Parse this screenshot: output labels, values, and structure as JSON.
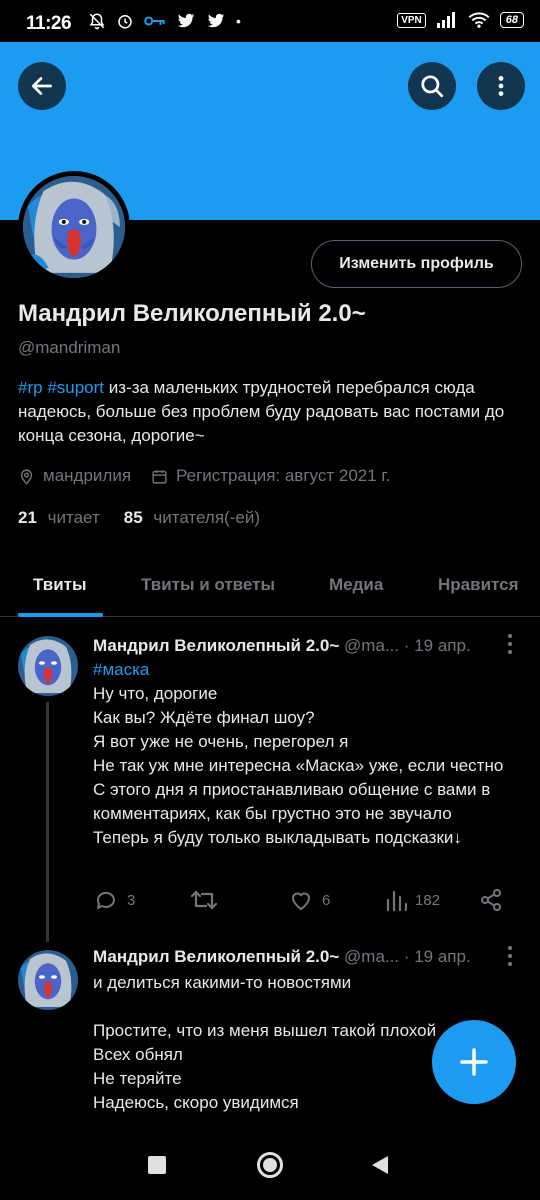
{
  "status_bar": {
    "time": "11:26",
    "vpn": "VPN",
    "battery": "68"
  },
  "profile": {
    "name": "Мандрил Великолепный 2.0~",
    "handle": "@mandriman",
    "edit_button": "Изменить профиль",
    "bio_tags": [
      "#rp",
      "#suport"
    ],
    "bio_text": "из-за маленьких трудностей перебрался сюда надеюсь, больше без проблем буду радовать вас постами до конца сезона, дорогие~",
    "location": "мандрилия",
    "joined": "Регистрация: август 2021 г.",
    "following_count": "21",
    "following_label": "читает",
    "followers_count": "85",
    "followers_label": "читателя(-ей)"
  },
  "tabs": [
    {
      "label": "Твиты"
    },
    {
      "label": "Твиты и ответы"
    },
    {
      "label": "Медиа"
    },
    {
      "label": "Нравится"
    }
  ],
  "tweets": [
    {
      "name": "Мандрил Великолепный 2.0~",
      "handle": "@ma...",
      "date": "· 19 апр.",
      "hashtag": "#маска",
      "lines": [
        "Ну что, дорогие",
        "Как вы? Ждёте финал шоу?",
        "Я вот уже не очень, перегорел я",
        "Не так уж мне интересна «Маска» уже, если честно",
        "С этого дня я приостанавливаю общение с вами в комментариях, как бы грустно это не звучало",
        "Теперь я буду только выкладывать подсказки↓"
      ],
      "replies": "3",
      "retweets": "",
      "likes": "6",
      "views": "182"
    },
    {
      "name": "Мандрил Великолепный 2.0~",
      "handle": "@ma...",
      "date": "· 19 апр.",
      "lines": [
        "и делиться какими-то новостями",
        "",
        "Простите, что из меня вышел такой плохой ...а:(",
        "Всех обнял",
        "Не теряйте",
        "Надеюсь, скоро увидимся"
      ]
    }
  ],
  "colors": {
    "accent": "#1d9bf0",
    "background": "#000000",
    "secondary_text": "#71767b"
  }
}
